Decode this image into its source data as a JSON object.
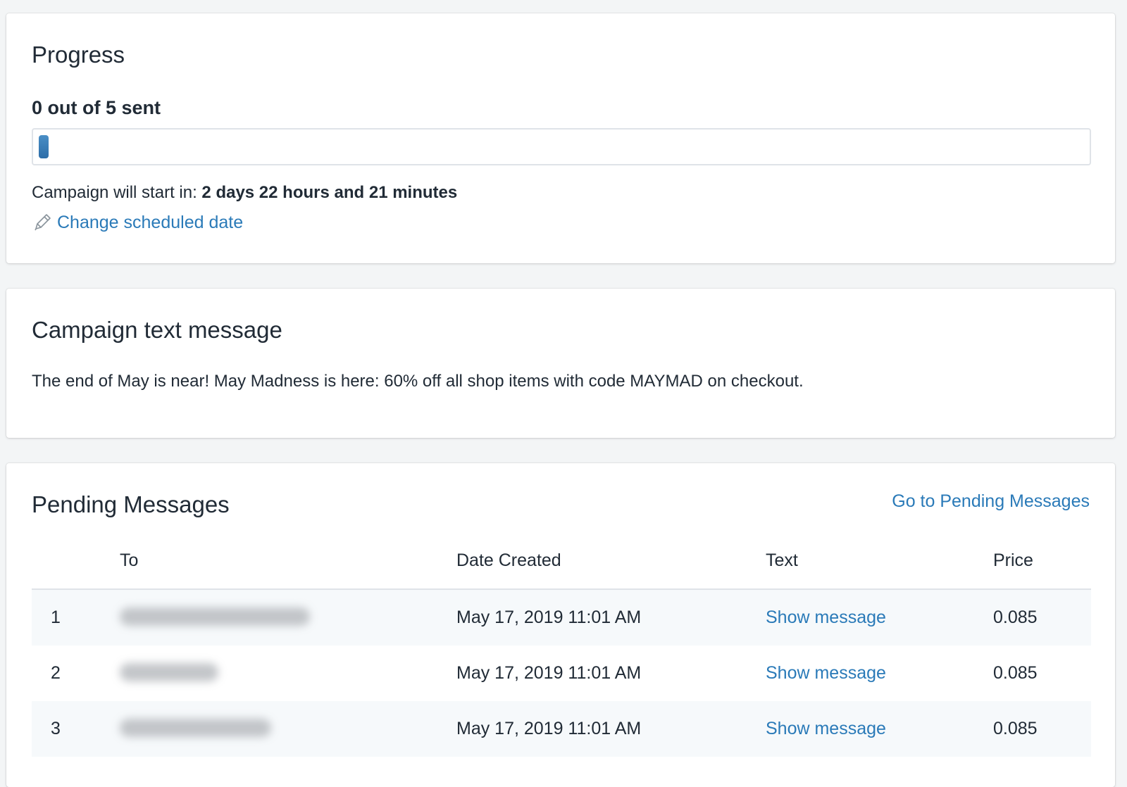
{
  "progress": {
    "title": "Progress",
    "sent_label": "0 out of 5 sent",
    "sent": 0,
    "total": 5,
    "start_prefix": "Campaign will start in:",
    "start_value": "2 days 22 hours and 21 minutes",
    "change_link": "Change scheduled date"
  },
  "message": {
    "title": "Campaign text message",
    "body": "The end of May is near! May Madness is here: 60% off all shop items with code MAYMAD on checkout."
  },
  "pending": {
    "title": "Pending Messages",
    "link": "Go to Pending Messages",
    "columns": [
      "To",
      "Date Created",
      "Text",
      "Price"
    ],
    "rows": [
      {
        "index": "1",
        "date": "May 17, 2019 11:01 AM",
        "text": "Show message",
        "price": "0.085"
      },
      {
        "index": "2",
        "date": "May 17, 2019 11:01 AM",
        "text": "Show message",
        "price": "0.085"
      },
      {
        "index": "3",
        "date": "May 17, 2019 11:01 AM",
        "text": "Show message",
        "price": "0.085"
      }
    ]
  },
  "colors": {
    "link": "#2a7ab8",
    "progress_fill": "#2d6ea8",
    "page_background": "#f3f5f6"
  }
}
